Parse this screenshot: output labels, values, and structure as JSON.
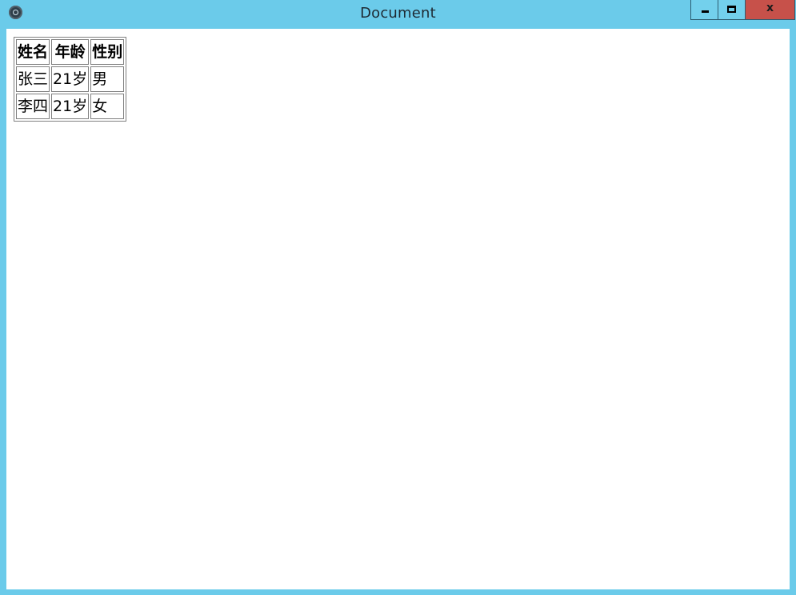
{
  "window": {
    "title": "Document",
    "controls": {
      "minimize_icon": "minimize-icon",
      "maximize_icon": "maximize-icon",
      "close_label": "x"
    },
    "colors": {
      "frame": "#6bcbea",
      "close_button": "#c7514a",
      "content_background": "#ffffff"
    }
  },
  "table": {
    "headers": [
      "姓名",
      "年龄",
      "性别"
    ],
    "rows": [
      [
        "张三",
        "21岁",
        "男"
      ],
      [
        "李四",
        "21岁",
        "女"
      ]
    ]
  }
}
